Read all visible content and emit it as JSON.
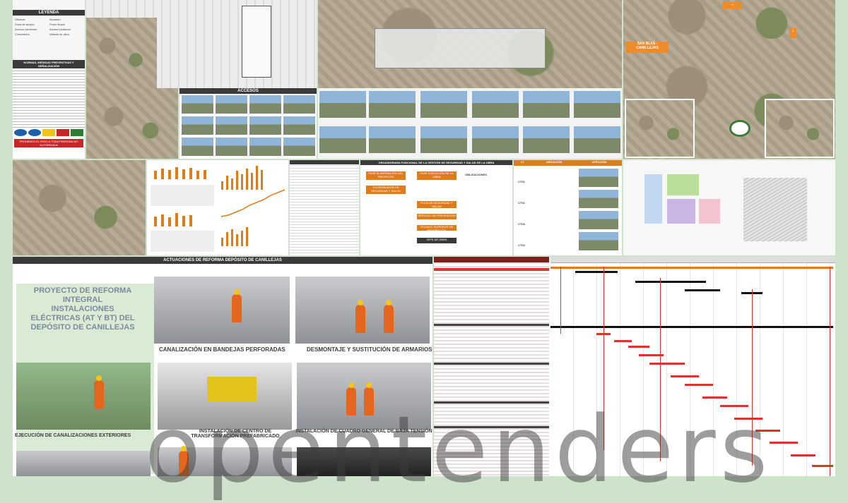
{
  "legend": {
    "title": "LEYENDA",
    "items": [
      "Oficinas",
      "Almacén",
      "Zona de acopio",
      "Punto limpio",
      "Acceso camiones",
      "Acceso peatonal",
      "Contenedor",
      "Vallado de obra"
    ]
  },
  "normas": {
    "title": "NORMAS, MEDIDAS PREVENTIVAS Y SEÑALIZACIÓN",
    "sign_text": "PROHIBIDO EL PASO A TODA PERSONA NO AUTORIZADA"
  },
  "accesos": {
    "title": "ACCESOS"
  },
  "san_blas": {
    "label": "SAN BLAS - CANILLEJAS"
  },
  "organigrama": {
    "title": "ORGANIGRAMA FUNCIONAL DE LA GESTIÓN DE SEGURIDAD Y SALUD DE LA OBRA",
    "boxes": [
      "FASE ELABORACIÓN DEL PROYECTO",
      "FASE EJECUCIÓN DE LA OBRA",
      "COORDINADOR DE SEGURIDAD Y SALUD",
      "PLAN DE SEGURIDAD Y SALUD",
      "SERVICIO DE PREVENCIÓN",
      "TÉCNICO SUPERIOR DE PREVENCIÓN",
      "JEFE DE OBRA"
    ],
    "side_title": "OBLIGACIONES"
  },
  "ct_table": {
    "headers": [
      "CT",
      "UBICACIÓN",
      "AFECCIÓN"
    ],
    "rows": [
      "CT01",
      "CT02",
      "CT03",
      "CT04"
    ]
  },
  "reforma": {
    "header": "ACTUACIONES DE REFORMA DEPÓSITO DE CANILLEJAS",
    "project_title": "PROYECTO DE REFORMA INTEGRAL INSTALACIONES ELÉCTRICAS (AT Y BT) DEL DEPÓSITO DE CANILLEJAS",
    "captions": {
      "canalizacion": "CANALIZACIÓN EN BANDEJAS PERFORADAS",
      "desmontaje": "DESMONTAJE Y SUSTITUCIÓN DE ARMARIOS",
      "exteriores": "EJECUCIÓN DE CANALIZACIONES EXTERIORES",
      "centro": "INSTALACIÓN DE CENTRO DE TRANSFORMACIÓN PREFABRICADO",
      "cuadro": "INSTALACIÓN DE CUADRO GENERAL DE BAJA TENSIÓN"
    }
  },
  "watermark": "opentenders",
  "colors": {
    "accent": "#e07b1a",
    "gantt_red": "#d9352a",
    "background": "#cfe3cc"
  }
}
